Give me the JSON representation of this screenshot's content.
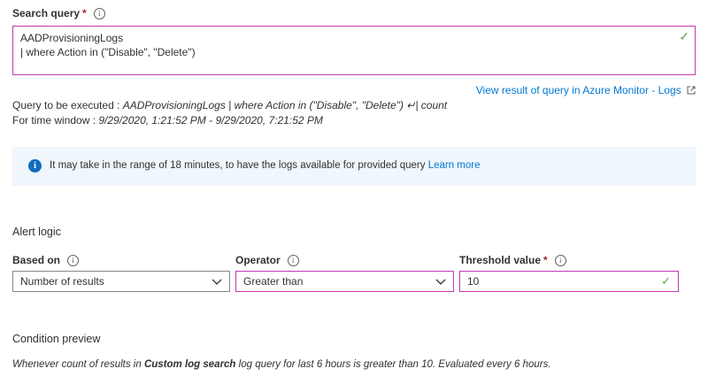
{
  "search_query": {
    "label": "Search query",
    "required_marker": "*",
    "info_glyph": "i",
    "lines": [
      "AADProvisioningLogs",
      "| where Action in (\"Disable\", \"Delete\")"
    ],
    "valid_glyph": "✓"
  },
  "view_result_link": "View result of query in Azure Monitor - Logs",
  "query_to_execute": {
    "prefix": "Query to be executed : ",
    "value": "AADProvisioningLogs | where Action in (\"Disable\", \"Delete\") ↵| count"
  },
  "time_window": {
    "prefix": "For time window : ",
    "value": "9/29/2020, 1:21:52 PM - 9/29/2020, 7:21:52 PM"
  },
  "info_banner": {
    "icon_glyph": "i",
    "text": "It may take in the range of 18 minutes, to have the logs available for provided query",
    "link": "Learn more"
  },
  "alert_logic": {
    "heading": "Alert logic",
    "based_on": {
      "label": "Based on",
      "value": "Number of results"
    },
    "operator": {
      "label": "Operator",
      "value": "Greater than"
    },
    "threshold": {
      "label": "Threshold value",
      "required_marker": "*",
      "value": "10",
      "valid_glyph": "✓"
    }
  },
  "condition_preview": {
    "heading": "Condition preview",
    "text_1": "Whenever count of results in ",
    "bold": "Custom log search",
    "text_2": " log query for last 6 hours is greater than 10. Evaluated every 6 hours."
  },
  "colors": {
    "accent_border": "#c239b3",
    "link": "#0078d4",
    "banner_bg": "#eff6fc",
    "check": "#5da24b",
    "required": "#a4262c"
  }
}
